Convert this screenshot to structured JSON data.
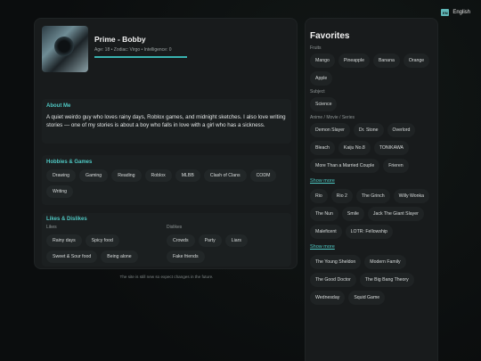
{
  "lang": {
    "label": "English",
    "flag": "EN"
  },
  "profile": {
    "name": "Prime - Bobby",
    "meta": "Age: 18 • Zodiac: Virgo • Intelligence: 0"
  },
  "about": {
    "title": "About Me",
    "text": "A quiet weirdo guy who loves rainy days, Roblox games, and midnight sketches. I also love writing stories — one of my stories is about a boy who falls in love with a girl who has a sickness."
  },
  "hobbies": {
    "title": "Hobbies & Games",
    "items": [
      "Drawing",
      "Gaming",
      "Reading",
      "Roblox",
      "MLBB",
      "Clash of Clans",
      "CODM",
      "Writing"
    ]
  },
  "likes_dislikes": {
    "title": "Likes & Dislikes",
    "likes_label": "Likes",
    "dislikes_label": "Dislikes",
    "likes": [
      "Rainy days",
      "Spicy food",
      "Sweet & Sour food",
      "Being alone"
    ],
    "dislikes": [
      "Crowds",
      "Party",
      "Liars",
      "Fake friends"
    ]
  },
  "footnote": "The site is still new so expect changes in the future.",
  "favorites": {
    "title": "Favorites",
    "fruits_label": "Fruits",
    "fruits": [
      "Mango",
      "Pineapple",
      "Banana",
      "Orange",
      "Apple"
    ],
    "subject_label": "Subject",
    "subjects": [
      "Science"
    ],
    "anime_label": "Anime / Movie / Series",
    "anime": [
      "Demon Slayer",
      "Dr. Stone",
      "Overlord",
      "Bleach",
      "Kaiju No.8",
      "TONIKAWA",
      "More Than a Married Couple",
      "Frieren"
    ],
    "show_more_1": "Show more",
    "movies": [
      "Rio",
      "Rio 2",
      "The Grinch",
      "Willy Wonka",
      "The Nun",
      "Smile",
      "Jack The Giant Slayer",
      "Maleficent",
      "LOTR: Fellowship"
    ],
    "show_more_2": "Show more",
    "series": [
      "The Young Sheldon",
      "Modern Family",
      "The Good Doctor",
      "The Big Bang Theory",
      "Wednesday",
      "Squid Game"
    ]
  }
}
